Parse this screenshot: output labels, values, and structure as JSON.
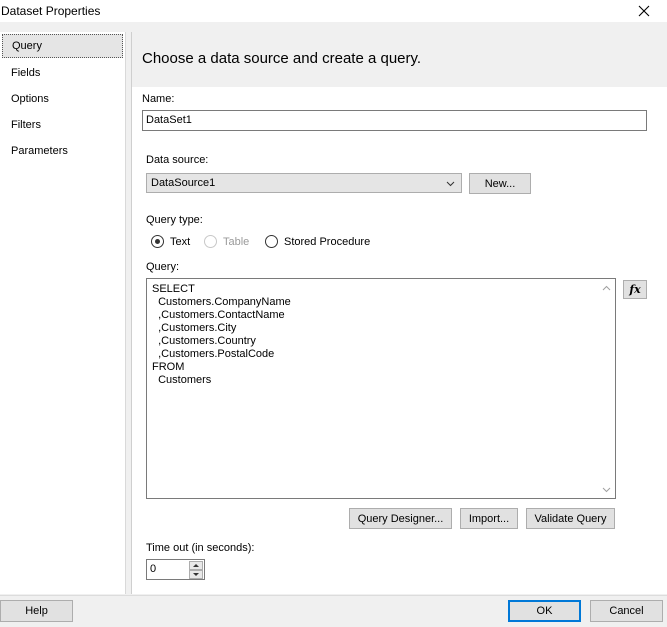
{
  "window": {
    "title": "Dataset Properties"
  },
  "nav": {
    "items": [
      {
        "label": "Query",
        "selected": true
      },
      {
        "label": "Fields"
      },
      {
        "label": "Options"
      },
      {
        "label": "Filters"
      },
      {
        "label": "Parameters"
      }
    ]
  },
  "header": {
    "text": "Choose a data source and create a query."
  },
  "name": {
    "label": "Name:",
    "value": "DataSet1"
  },
  "datasource": {
    "label": "Data source:",
    "value": "DataSource1",
    "new_label": "New..."
  },
  "querytype": {
    "label": "Query type:",
    "options": [
      {
        "label": "Text",
        "checked": true
      },
      {
        "label": "Table",
        "disabled": true
      },
      {
        "label": "Stored Procedure"
      }
    ]
  },
  "query": {
    "label": "Query:",
    "lines": [
      "SELECT",
      "  Customers.CompanyName",
      "  ,Customers.ContactName",
      "  ,Customers.City",
      "  ,Customers.Country",
      "  ,Customers.PostalCode",
      "FROM",
      "  Customers"
    ]
  },
  "buttons": {
    "query_designer": "Query Designer...",
    "import": "Import...",
    "validate": "Validate Query",
    "help": "Help",
    "ok": "OK",
    "cancel": "Cancel"
  },
  "timeout": {
    "label": "Time out (in seconds):",
    "value": "0"
  }
}
